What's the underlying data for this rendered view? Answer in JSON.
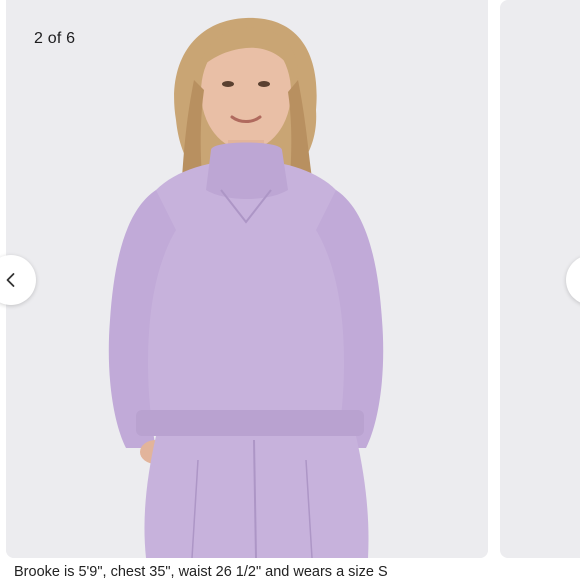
{
  "carousel": {
    "counter": "2 of 6",
    "prev_icon": "chevron-left-icon",
    "next_icon": "chevron-right-icon"
  },
  "caption": {
    "text": "Brooke is 5'9\", chest 35\", waist 26 1/2\" and wears a size S"
  },
  "colors": {
    "background": "#ececef",
    "sweatshirt": "#c7b2dc"
  }
}
